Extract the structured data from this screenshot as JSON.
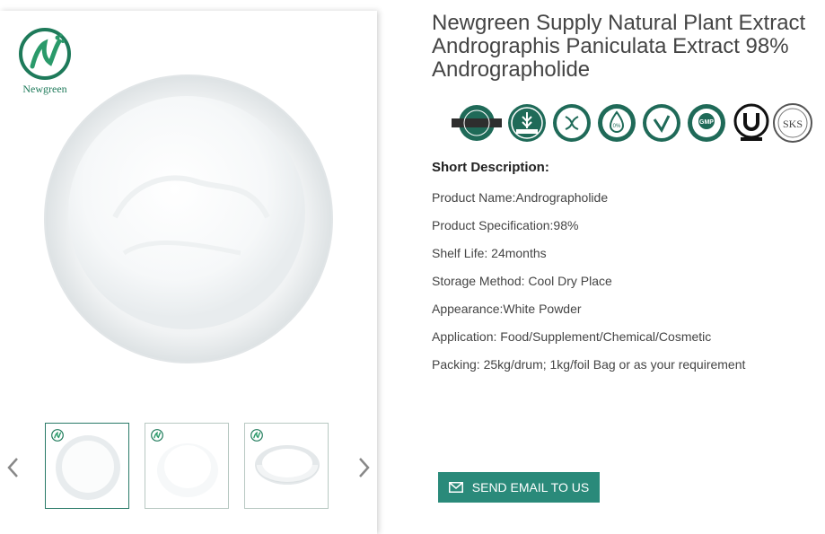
{
  "brand": {
    "name": "Newgreen",
    "color": "#1e7a5a"
  },
  "product": {
    "title": "Newgreen Supply Natural Plant Extract Andrographis Paniculata Extract 98% Andrographolide"
  },
  "badges": [
    {
      "icon": "natural-ingredients-icon",
      "text": "NATURAL INGREDIENTS"
    },
    {
      "icon": "gluten-free-icon",
      "text": "GLUTEN FREE"
    },
    {
      "icon": "gmo-free-icon",
      "text": "GMO FREE"
    },
    {
      "icon": "no-preservatives-icon",
      "text": "PRESERVATIVES NO ADDED"
    },
    {
      "icon": "vegan-friendly-icon",
      "text": "VEGAN FRIENDLY"
    },
    {
      "icon": "gmp-certified-icon",
      "text": "GMP CERTIFIED"
    },
    {
      "icon": "kosher-u-icon",
      "text": "KOSHER"
    },
    {
      "icon": "kosher-sks-icon",
      "text": "Kosher SKS"
    }
  ],
  "description": {
    "heading": "Short Description:",
    "items": [
      "Product Name:Andrographolide",
      "Product Specification:98%",
      "Shelf Life: 24months",
      "Storage Method: Cool Dry Place",
      "Appearance:White Powder",
      "Application: Food/Supplement/Chemical/Cosmetic",
      "Packing: 25kg/drum; 1kg/foil Bag or as your requirement"
    ]
  },
  "actions": {
    "email_label": "SEND EMAIL TO US"
  },
  "colors": {
    "accent": "#2a8a7a",
    "badge": "#1f6a58"
  }
}
